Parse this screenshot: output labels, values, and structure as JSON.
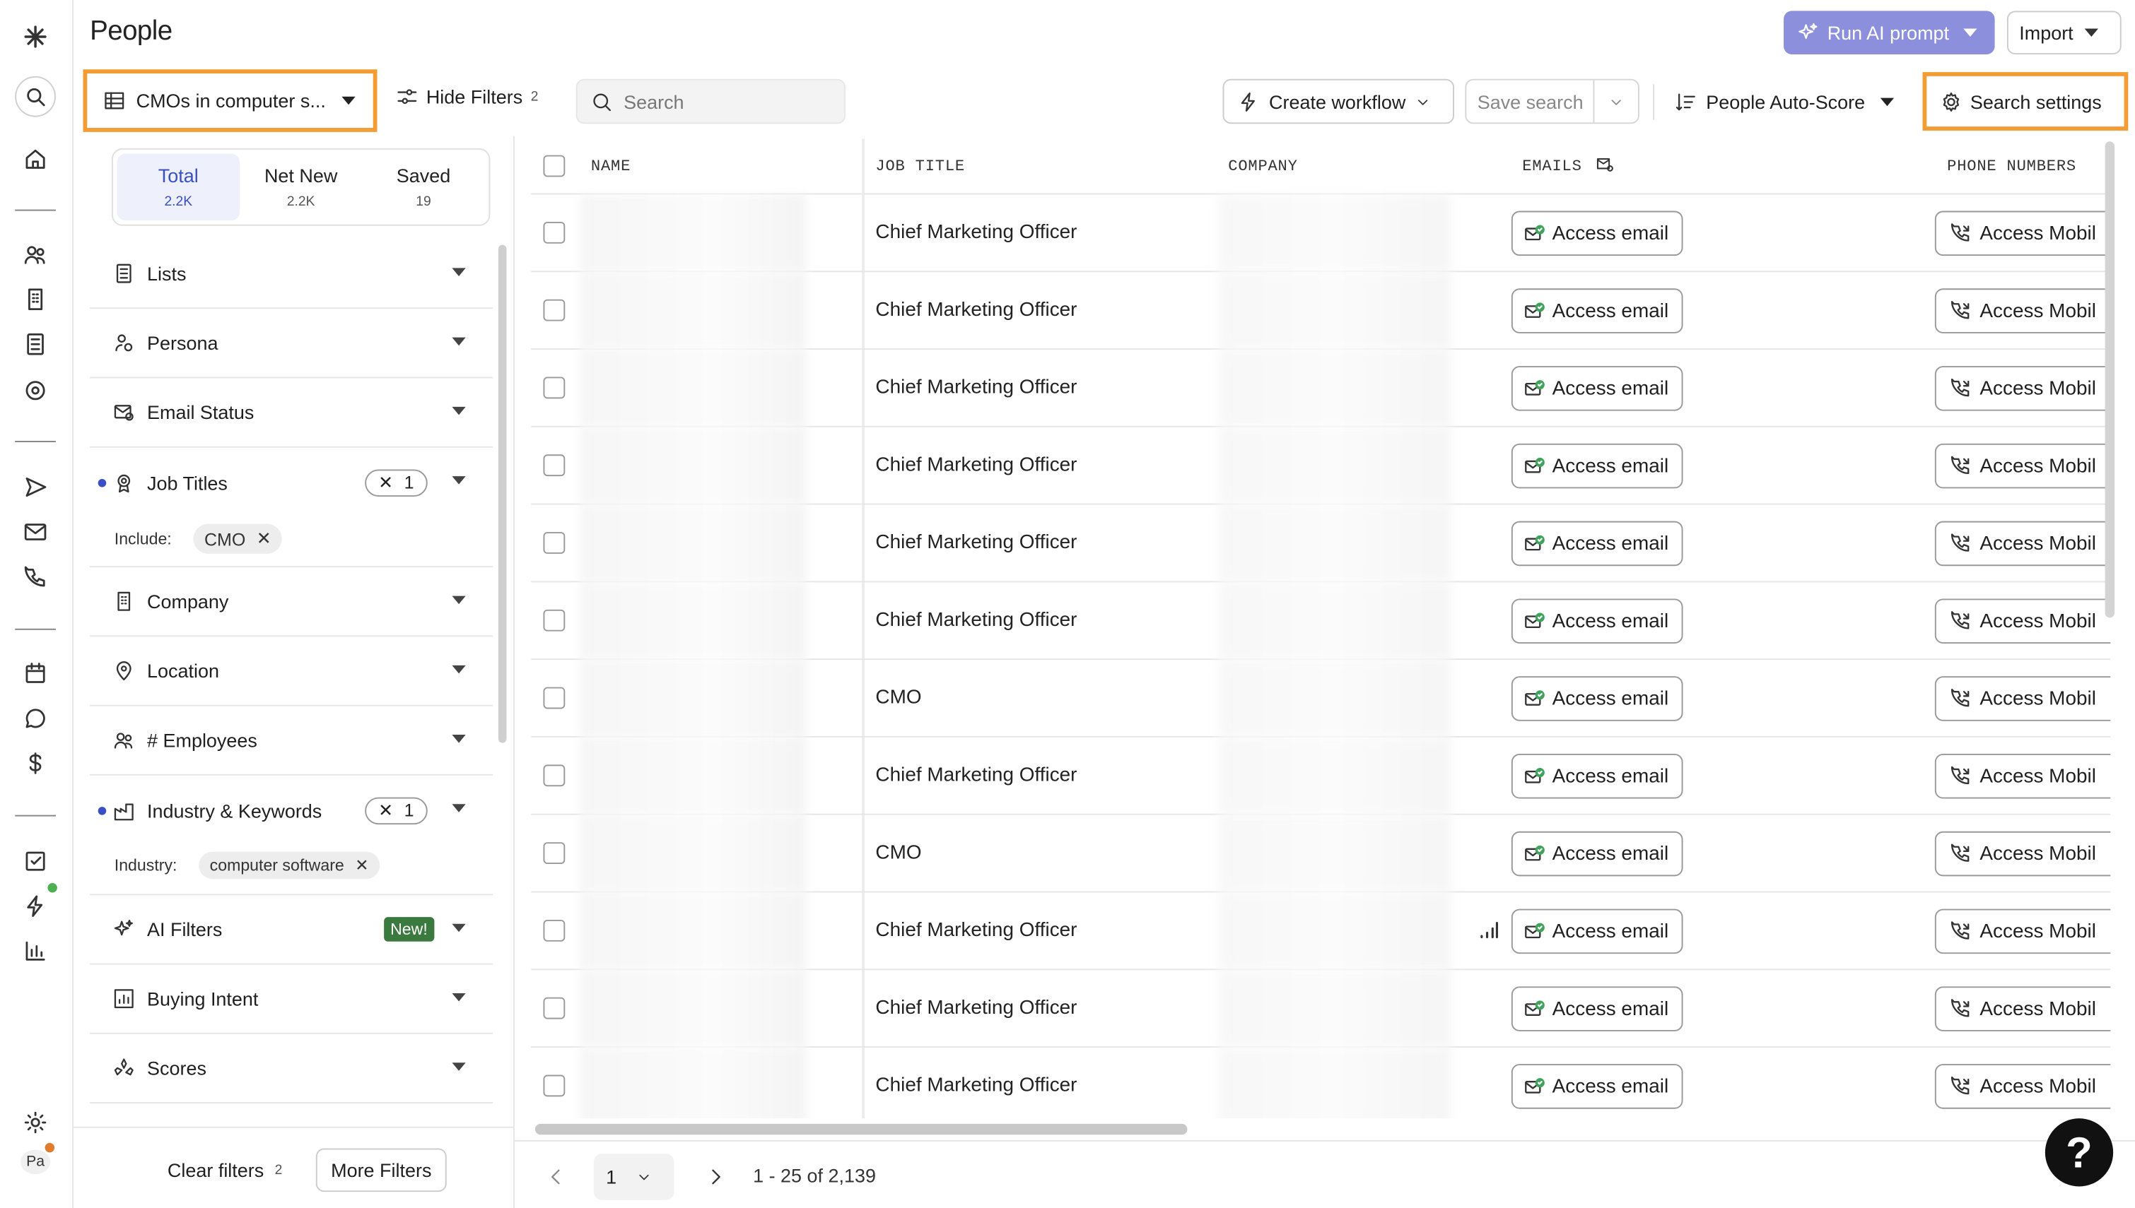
{
  "header": {
    "title": "People",
    "run_ai_label": "Run AI prompt",
    "import_label": "Import"
  },
  "toolbar": {
    "view_name": "CMOs in computer s...",
    "hide_filters_label": "Hide Filters",
    "hide_filters_count": "2",
    "search_placeholder": "Search",
    "create_workflow_label": "Create workflow",
    "save_search_label": "Save search",
    "auto_score_label": "People Auto-Score",
    "search_settings_label": "Search settings"
  },
  "tabs": [
    {
      "label": "Total",
      "count": "2.2K"
    },
    {
      "label": "Net New",
      "count": "2.2K"
    },
    {
      "label": "Saved",
      "count": "19"
    }
  ],
  "filters": {
    "lists": "Lists",
    "persona": "Persona",
    "email_status": "Email Status",
    "job_titles": "Job Titles",
    "job_titles_count": "1",
    "include_label": "Include:",
    "include_value": "CMO",
    "company": "Company",
    "location": "Location",
    "employees": "# Employees",
    "industry": "Industry & Keywords",
    "industry_count": "1",
    "industry_label": "Industry:",
    "industry_value": "computer software",
    "ai_filters": "AI Filters",
    "new_badge": "New!",
    "buying_intent": "Buying Intent",
    "scores": "Scores",
    "clear_label": "Clear filters",
    "clear_count": "2",
    "more_label": "More Filters"
  },
  "table": {
    "columns": {
      "name": "NAME",
      "job_title": "JOB TITLE",
      "company": "COMPANY",
      "emails": "EMAILS",
      "phone": "PHONE NUMBERS"
    },
    "email_button": "Access email",
    "mobile_button": "Access Mobil",
    "rows": [
      {
        "job_title": "Chief Marketing Officer"
      },
      {
        "job_title": "Chief Marketing Officer"
      },
      {
        "job_title": "Chief Marketing Officer"
      },
      {
        "job_title": "Chief Marketing Officer"
      },
      {
        "job_title": "Chief Marketing Officer"
      },
      {
        "job_title": "Chief Marketing Officer"
      },
      {
        "job_title": "CMO"
      },
      {
        "job_title": "Chief Marketing Officer"
      },
      {
        "job_title": "CMO"
      },
      {
        "job_title": "Chief Marketing Officer"
      },
      {
        "job_title": "Chief Marketing Officer"
      },
      {
        "job_title": "Chief Marketing Officer"
      }
    ]
  },
  "pagination": {
    "page": "1",
    "range": "1 - 25 of 2,139"
  },
  "user": {
    "initials": "Pa"
  },
  "help_label": "?",
  "colors": {
    "accent": "#3a4fc3",
    "highlight": "#f29c33",
    "ai_button": "#8c90dc",
    "new_badge": "#3b7a3e"
  }
}
